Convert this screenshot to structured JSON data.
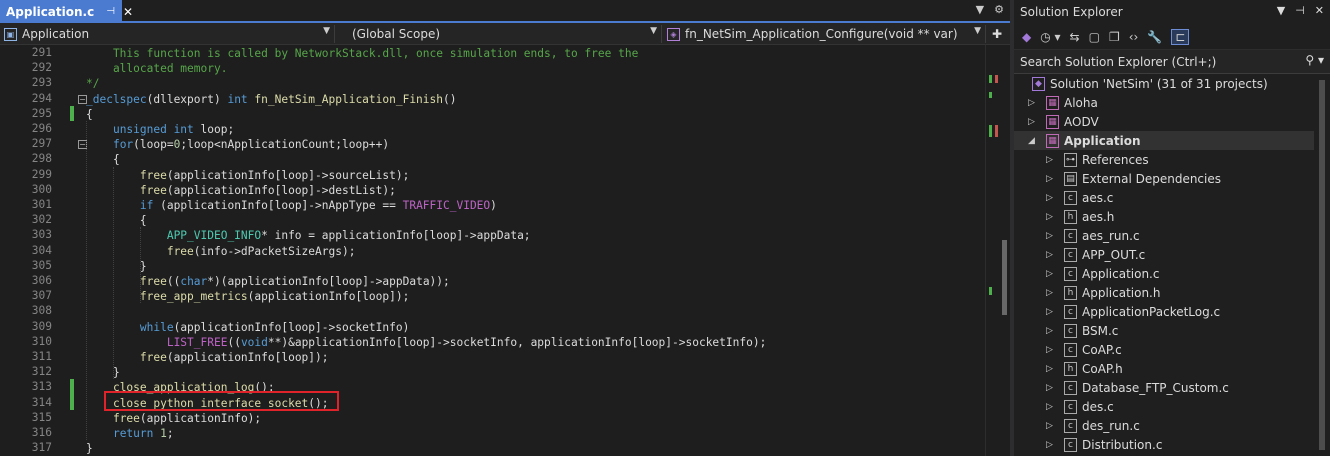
{
  "colors": {
    "keyword": "#569cd6",
    "comment": "#57a64a",
    "function": "#dcdcaa",
    "macro": "#bd63c5",
    "type": "#4ec9b0",
    "number": "#b5cea8",
    "text": "#dcdcdc",
    "accent": "#4a7bd1",
    "highlight": "#e0222a"
  },
  "tab": {
    "title": "Application.c",
    "pin_icon": "pin-icon",
    "close_icon": "close-icon"
  },
  "nav": {
    "project": "Application",
    "scope": "(Global Scope)",
    "member": "fn_NetSim_Application_Configure(void ** var)"
  },
  "lines": [
    {
      "n": "291",
      "segs": [
        [
          "    This function is called by NetworkStack.dll, once simulation ends, to free the",
          "comment"
        ]
      ]
    },
    {
      "n": "292",
      "segs": [
        [
          "    allocated memory.",
          "comment"
        ]
      ]
    },
    {
      "n": "293",
      "segs": [
        [
          "*/",
          "comment"
        ]
      ]
    },
    {
      "n": "294",
      "segs": [
        [
          "_declspec",
          "keyword"
        ],
        [
          "(dllexport) ",
          "text"
        ],
        [
          "int",
          "keyword"
        ],
        [
          " fn_NetSim_Application_Finish",
          "function"
        ],
        [
          "()",
          "text"
        ]
      ]
    },
    {
      "n": "295",
      "segs": [
        [
          "{",
          "text"
        ]
      ]
    },
    {
      "n": "296",
      "segs": [
        [
          "    ",
          "text"
        ],
        [
          "unsigned int",
          "keyword"
        ],
        [
          " loop;",
          "text"
        ]
      ]
    },
    {
      "n": "297",
      "segs": [
        [
          "    ",
          "text"
        ],
        [
          "for",
          "keyword"
        ],
        [
          "(loop=",
          "text"
        ],
        [
          "0",
          "number"
        ],
        [
          ";loop<nApplicationCount;loop++)",
          "text"
        ]
      ]
    },
    {
      "n": "298",
      "segs": [
        [
          "    {",
          "text"
        ]
      ]
    },
    {
      "n": "299",
      "segs": [
        [
          "        ",
          "text"
        ],
        [
          "free",
          "function"
        ],
        [
          "(applicationInfo[loop]->sourceList);",
          "text"
        ]
      ]
    },
    {
      "n": "300",
      "segs": [
        [
          "        ",
          "text"
        ],
        [
          "free",
          "function"
        ],
        [
          "(applicationInfo[loop]->destList);",
          "text"
        ]
      ]
    },
    {
      "n": "301",
      "segs": [
        [
          "        ",
          "text"
        ],
        [
          "if",
          "keyword"
        ],
        [
          " (applicationInfo[loop]->nAppType == ",
          "text"
        ],
        [
          "TRAFFIC_VIDEO",
          "macro"
        ],
        [
          ")",
          "text"
        ]
      ]
    },
    {
      "n": "302",
      "segs": [
        [
          "        {",
          "text"
        ]
      ]
    },
    {
      "n": "303",
      "segs": [
        [
          "            ",
          "text"
        ],
        [
          "APP_VIDEO_INFO",
          "type"
        ],
        [
          "* info = applicationInfo[loop]->appData;",
          "text"
        ]
      ]
    },
    {
      "n": "304",
      "segs": [
        [
          "            ",
          "text"
        ],
        [
          "free",
          "function"
        ],
        [
          "(info->dPacketSizeArgs);",
          "text"
        ]
      ]
    },
    {
      "n": "305",
      "segs": [
        [
          "        }",
          "text"
        ]
      ]
    },
    {
      "n": "306",
      "segs": [
        [
          "        ",
          "text"
        ],
        [
          "free",
          "function"
        ],
        [
          "((",
          "text"
        ],
        [
          "char",
          "keyword"
        ],
        [
          "*)(applicationInfo[loop]->appData));",
          "text"
        ]
      ]
    },
    {
      "n": "307",
      "segs": [
        [
          "        ",
          "text"
        ],
        [
          "free_app_metrics",
          "function"
        ],
        [
          "(applicationInfo[loop]);",
          "text"
        ]
      ]
    },
    {
      "n": "308",
      "segs": [
        [
          "",
          "text"
        ]
      ]
    },
    {
      "n": "309",
      "segs": [
        [
          "        ",
          "text"
        ],
        [
          "while",
          "keyword"
        ],
        [
          "(applicationInfo[loop]->socketInfo)",
          "text"
        ]
      ]
    },
    {
      "n": "310",
      "segs": [
        [
          "            ",
          "text"
        ],
        [
          "LIST_FREE",
          "macro"
        ],
        [
          "((",
          "text"
        ],
        [
          "void",
          "keyword"
        ],
        [
          "**)&applicationInfo[loop]->socketInfo, applicationInfo[loop]->socketInfo);",
          "text"
        ]
      ]
    },
    {
      "n": "311",
      "segs": [
        [
          "        ",
          "text"
        ],
        [
          "free",
          "function"
        ],
        [
          "(applicationInfo[loop]);",
          "text"
        ]
      ]
    },
    {
      "n": "312",
      "segs": [
        [
          "    }",
          "text"
        ]
      ]
    },
    {
      "n": "313",
      "segs": [
        [
          "    ",
          "text"
        ],
        [
          "close_application_log",
          "function"
        ],
        [
          "();",
          "text"
        ]
      ]
    },
    {
      "n": "314",
      "segs": [
        [
          "    ",
          "text"
        ],
        [
          "close_python_interface_socket",
          "function"
        ],
        [
          "();",
          "text"
        ]
      ]
    },
    {
      "n": "315",
      "segs": [
        [
          "    ",
          "text"
        ],
        [
          "free",
          "function"
        ],
        [
          "(applicationInfo);",
          "text"
        ]
      ]
    },
    {
      "n": "316",
      "segs": [
        [
          "    ",
          "text"
        ],
        [
          "return",
          "keyword"
        ],
        [
          " ",
          "text"
        ],
        [
          "1",
          "number"
        ],
        [
          ";",
          "text"
        ]
      ]
    },
    {
      "n": "317",
      "segs": [
        [
          "}",
          "text"
        ]
      ]
    }
  ],
  "solution_explorer": {
    "title": "Solution Explorer",
    "search_placeholder": "Search Solution Explorer (Ctrl+;)",
    "items": [
      {
        "label": "Solution 'NetSim' (31 of 31 projects)",
        "icon": "solution-icon",
        "depth": 0,
        "arrow": ""
      },
      {
        "label": "Aloha",
        "icon": "project-icon",
        "depth": 0,
        "arrow": "▷"
      },
      {
        "label": "AODV",
        "icon": "project-icon",
        "depth": 0,
        "arrow": "▷"
      },
      {
        "label": "Application",
        "icon": "project-icon",
        "depth": 0,
        "arrow": "◢",
        "selected": true
      },
      {
        "label": "References",
        "icon": "references-icon",
        "depth": 1,
        "arrow": "▷"
      },
      {
        "label": "External Dependencies",
        "icon": "folder-icon",
        "depth": 1,
        "arrow": "▷"
      },
      {
        "label": "aes.c",
        "icon": "c-file-icon",
        "depth": 1,
        "arrow": "▷"
      },
      {
        "label": "aes.h",
        "icon": "h-file-icon",
        "depth": 1,
        "arrow": "▷"
      },
      {
        "label": "aes_run.c",
        "icon": "c-file-icon",
        "depth": 1,
        "arrow": "▷"
      },
      {
        "label": "APP_OUT.c",
        "icon": "c-file-icon",
        "depth": 1,
        "arrow": "▷"
      },
      {
        "label": "Application.c",
        "icon": "c-file-icon",
        "depth": 1,
        "arrow": "▷"
      },
      {
        "label": "Application.h",
        "icon": "h-file-icon",
        "depth": 1,
        "arrow": "▷"
      },
      {
        "label": "ApplicationPacketLog.c",
        "icon": "c-file-icon",
        "depth": 1,
        "arrow": "▷"
      },
      {
        "label": "BSM.c",
        "icon": "c-file-icon",
        "depth": 1,
        "arrow": "▷"
      },
      {
        "label": "CoAP.c",
        "icon": "c-file-icon",
        "depth": 1,
        "arrow": "▷"
      },
      {
        "label": "CoAP.h",
        "icon": "h-file-icon",
        "depth": 1,
        "arrow": "▷"
      },
      {
        "label": "Database_FTP_Custom.c",
        "icon": "c-file-icon",
        "depth": 1,
        "arrow": "▷"
      },
      {
        "label": "des.c",
        "icon": "c-file-icon",
        "depth": 1,
        "arrow": "▷"
      },
      {
        "label": "des_run.c",
        "icon": "c-file-icon",
        "depth": 1,
        "arrow": "▷"
      },
      {
        "label": "Distribution.c",
        "icon": "c-file-icon",
        "depth": 1,
        "arrow": "▷"
      }
    ]
  }
}
